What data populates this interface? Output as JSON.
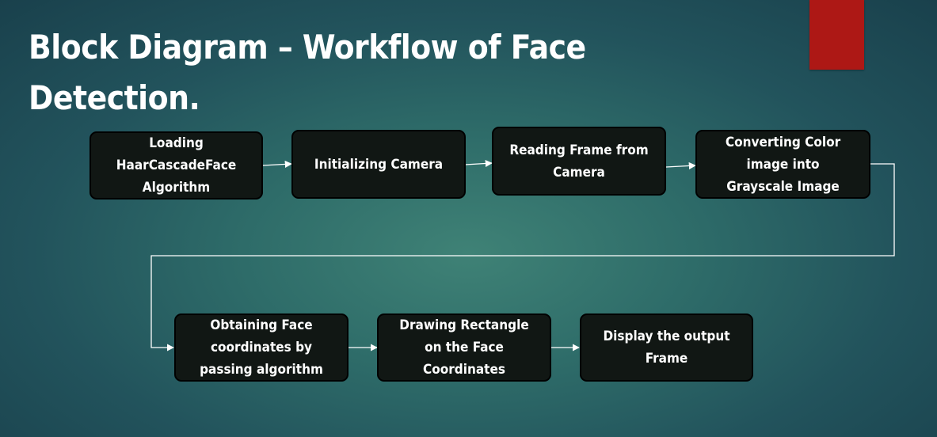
{
  "slide": {
    "title": "Block Diagram – Workflow of Face Detection."
  },
  "colors": {
    "accent": "#ad1815",
    "box_fill": "#111714",
    "box_border": "#000000",
    "connector": "#ffffff"
  },
  "diagram": {
    "steps": [
      {
        "label": "Loading\nHaarCascadeFace\nAlgorithm"
      },
      {
        "label": "Initializing Camera"
      },
      {
        "label": "Reading Frame from\nCamera"
      },
      {
        "label": "Converting Color\nimage into\nGrayscale Image"
      },
      {
        "label": "Obtaining Face\ncoordinates by\npassing algorithm"
      },
      {
        "label": "Drawing Rectangle\non the Face\nCoordinates"
      },
      {
        "label": "Display the output\nFrame"
      }
    ]
  }
}
